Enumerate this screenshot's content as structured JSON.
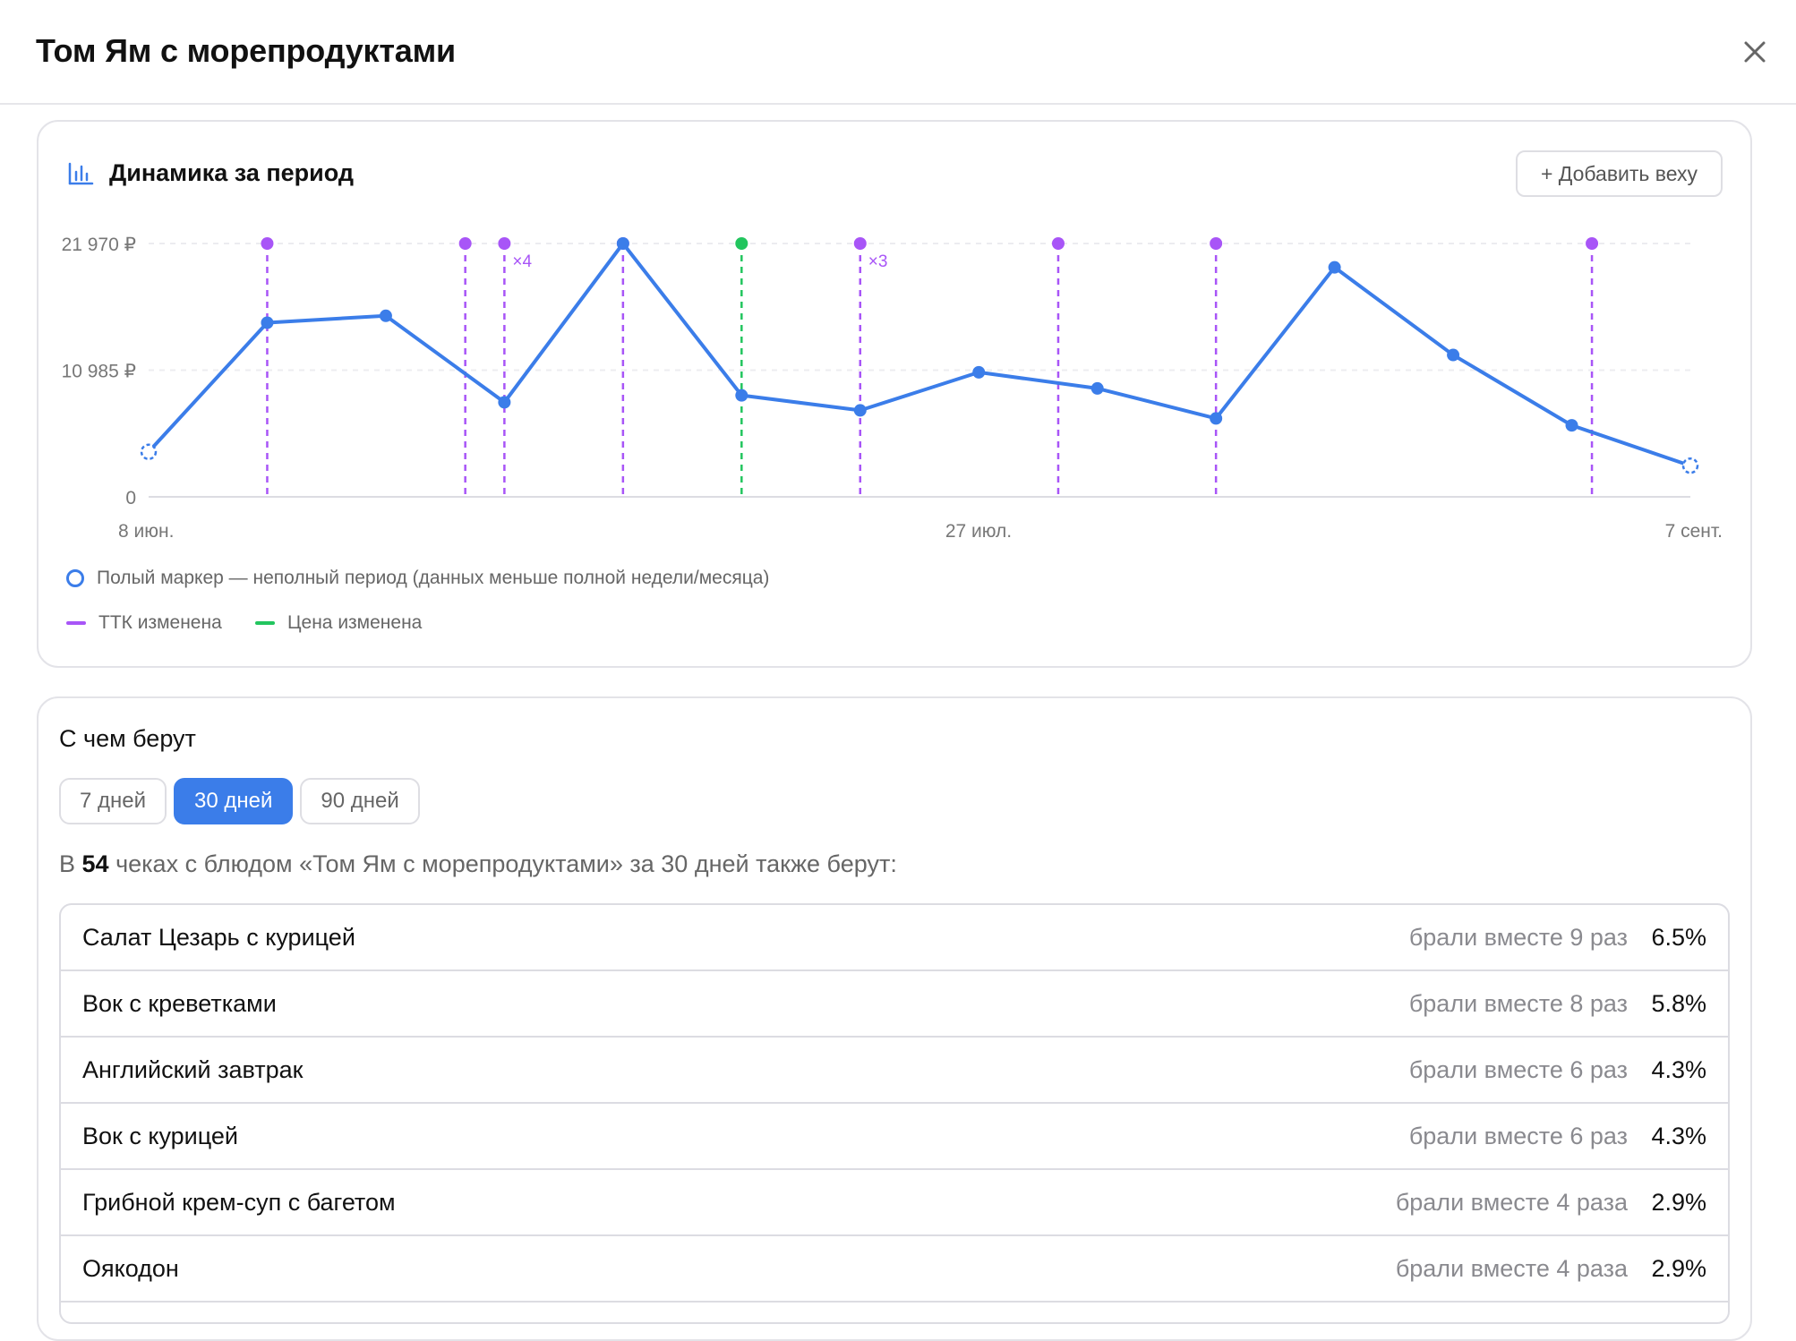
{
  "modal": {
    "title": "Том Ям с морепродуктами"
  },
  "dynamics": {
    "title": "Динамика за период",
    "add_milestone_label": "+ Добавить веху",
    "legend": {
      "hollow_marker": "Полый маркер — неполный период (данных меньше полной недели/месяца)",
      "ttk_changed": "ТТК изменена",
      "price_changed": "Цена изменена"
    }
  },
  "chart_data": {
    "type": "line",
    "y_ticks": [
      "21 970 ₽",
      "10 985 ₽",
      "0"
    ],
    "x_ticks": [
      "8 июн.",
      "27 июл.",
      "7 сент."
    ],
    "ylim": [
      0,
      21970
    ],
    "grid": true,
    "series": [
      {
        "color": "#3b7de9",
        "values": [
          3900,
          15100,
          15700,
          8200,
          21970,
          8800,
          7500,
          10800,
          9400,
          6800,
          19900,
          12300,
          6200,
          2700
        ],
        "incomplete": [
          true,
          false,
          false,
          false,
          false,
          false,
          false,
          false,
          false,
          false,
          false,
          false,
          false,
          true
        ]
      }
    ],
    "milestones": [
      {
        "index": 1,
        "kind": "ttk",
        "label": ""
      },
      {
        "index": 2.67,
        "kind": "ttk",
        "label": ""
      },
      {
        "index": 3,
        "kind": "ttk",
        "label": "×4"
      },
      {
        "index": 4,
        "kind": "ttk",
        "label": ""
      },
      {
        "index": 5,
        "kind": "price",
        "label": ""
      },
      {
        "index": 6,
        "kind": "ttk",
        "label": "×3"
      },
      {
        "index": 7.67,
        "kind": "ttk",
        "label": ""
      },
      {
        "index": 9,
        "kind": "ttk",
        "label": ""
      },
      {
        "index": 12.17,
        "kind": "ttk",
        "label": ""
      }
    ],
    "colors": {
      "line": "#3b7de9",
      "ttk": "#a855f7",
      "price": "#22c55e"
    }
  },
  "with_what": {
    "title": "С чем берут",
    "tabs": [
      {
        "label": "7 дней",
        "active": false
      },
      {
        "label": "30 дней",
        "active": true
      },
      {
        "label": "90 дней",
        "active": false
      }
    ],
    "summary_prefix": "В ",
    "summary_count": "54",
    "summary_suffix": " чеках с блюдом «Том Ям с морепродуктами» за 30 дней также берут:",
    "items": [
      {
        "name": "Салат Цезарь с курицей",
        "times": "брали вместе 9 раз",
        "pct": "6.5%"
      },
      {
        "name": "Вок с креветками",
        "times": "брали вместе 8 раз",
        "pct": "5.8%"
      },
      {
        "name": "Английский завтрак",
        "times": "брали вместе 6 раз",
        "pct": "4.3%"
      },
      {
        "name": "Вок с курицей",
        "times": "брали вместе 6 раз",
        "pct": "4.3%"
      },
      {
        "name": "Грибной крем-суп с багетом",
        "times": "брали вместе 4 раза",
        "pct": "2.9%"
      },
      {
        "name": "Оякодон",
        "times": "брали вместе 4 раза",
        "pct": "2.9%"
      }
    ]
  }
}
